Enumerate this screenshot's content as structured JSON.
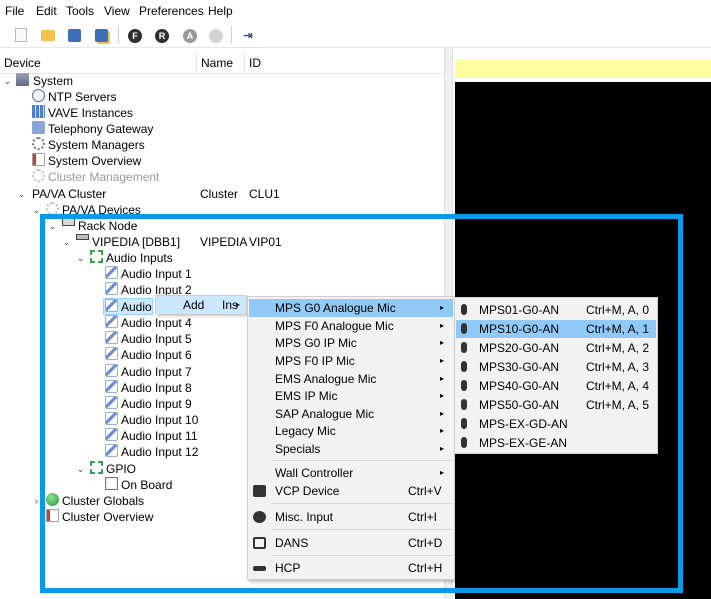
{
  "menubar": {
    "items": [
      "File",
      "Edit",
      "Tools",
      "View",
      "Preferences",
      "Help"
    ]
  },
  "toolbar": {
    "icons": [
      "new-document-icon",
      "open-folder-icon",
      "save-icon",
      "save-as-icon",
      "f-circle-icon",
      "r-circle-icon",
      "a-circle-icon",
      "globe-icon",
      "import-icon"
    ],
    "letters": {
      "f": "F",
      "r": "R",
      "a": "A"
    }
  },
  "columns": {
    "device": "Device",
    "name": "Name",
    "id": "ID"
  },
  "tree": {
    "system": "System",
    "ntp": "NTP Servers",
    "vave": "VAVE Instances",
    "telephony": "Telephony Gateway",
    "system_managers": "System Managers",
    "system_overview": "System Overview",
    "cluster_management": "Cluster Management",
    "pava_cluster": {
      "label": "PA/VA Cluster",
      "name": "Cluster",
      "id": "CLU1"
    },
    "pava_devices": "PA/VA Devices",
    "rack_node": "Rack Node",
    "vipedia": {
      "label": "VIPEDIA [DBB1]",
      "name": "VIPEDIA",
      "id": "VIP01"
    },
    "audio_inputs": "Audio Inputs",
    "inputs": [
      "Audio Input 1",
      "Audio Input 2",
      "Audio",
      "Audio Input 4",
      "Audio Input 5",
      "Audio Input 6",
      "Audio Input 7",
      "Audio Input 8",
      "Audio Input 9",
      "Audio Input 10",
      "Audio Input 11",
      "Audio Input 12"
    ],
    "gpio": "GPIO",
    "on_board": "On Board",
    "cluster_globals": "Cluster Globals",
    "cluster_overview": "Cluster Overview"
  },
  "context_menu": {
    "add": "Add",
    "ins": "Ins"
  },
  "submenu": {
    "items": [
      "MPS G0 Analogue Mic",
      "MPS F0 Analogue Mic",
      "MPS G0 IP Mic",
      "MPS F0 IP Mic",
      "EMS Analogue Mic",
      "EMS IP Mic",
      "SAP Analogue Mic",
      "Legacy Mic",
      "Specials"
    ],
    "wall_controller": "Wall Controller",
    "vcp_device": {
      "label": "VCP Device",
      "shortcut": "Ctrl+V"
    },
    "misc_input": {
      "label": "Misc. Input",
      "shortcut": "Ctrl+I"
    },
    "dans": {
      "label": "DANS",
      "shortcut": "Ctrl+D"
    },
    "hcp": {
      "label": "HCP",
      "shortcut": "Ctrl+H"
    }
  },
  "mic_menu": {
    "items": [
      {
        "label": "MPS01-G0-AN",
        "shortcut": "Ctrl+M, A, 0"
      },
      {
        "label": "MPS10-G0-AN",
        "shortcut": "Ctrl+M, A, 1"
      },
      {
        "label": "MPS20-G0-AN",
        "shortcut": "Ctrl+M, A, 2"
      },
      {
        "label": "MPS30-G0-AN",
        "shortcut": "Ctrl+M, A, 3"
      },
      {
        "label": "MPS40-G0-AN",
        "shortcut": "Ctrl+M, A, 4"
      },
      {
        "label": "MPS50-G0-AN",
        "shortcut": "Ctrl+M, A, 5"
      },
      {
        "label": "MPS-EX-GD-AN",
        "shortcut": ""
      },
      {
        "label": "MPS-EX-GE-AN",
        "shortcut": ""
      }
    ]
  },
  "colors": {
    "highlight_border": "#0b9ae8",
    "selected_item": "#91c9f7",
    "right_panel": "#000000",
    "status_strip": "#fdfea0"
  }
}
